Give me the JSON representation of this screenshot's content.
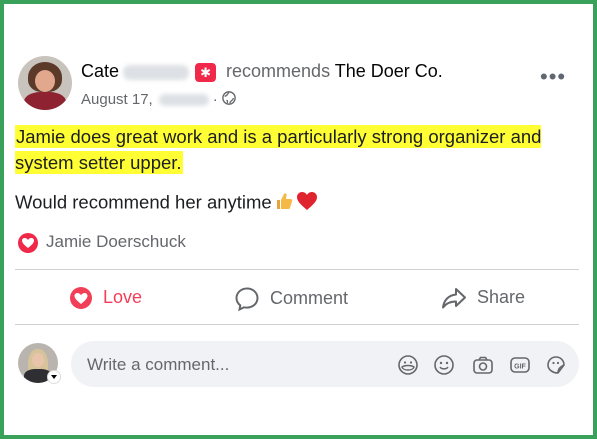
{
  "post": {
    "author_name": "Cate",
    "recommend_text": "recommends",
    "page_name": "The Doer Co.",
    "date": "August 17,",
    "separator": "·",
    "more_label": "•••",
    "highlight_text": "Jamie does great work and is a particularly strong organizer and system setter upper.",
    "body_text": "Would recommend her anytime",
    "reaction_user": "Jamie Doerschuck"
  },
  "actions": {
    "love_label": "Love",
    "comment_label": "Comment",
    "share_label": "Share"
  },
  "composer": {
    "placeholder": "Write a comment...",
    "icons": [
      "avatar-sticker-icon",
      "emoji-icon",
      "camera-icon",
      "gif-icon",
      "sticker-icon"
    ]
  },
  "colors": {
    "frame_border": "#3aa15a",
    "highlight": "#ffff33",
    "love": "#f33e58",
    "recommend_badge": "#f02849",
    "muted_text": "#65676b"
  }
}
